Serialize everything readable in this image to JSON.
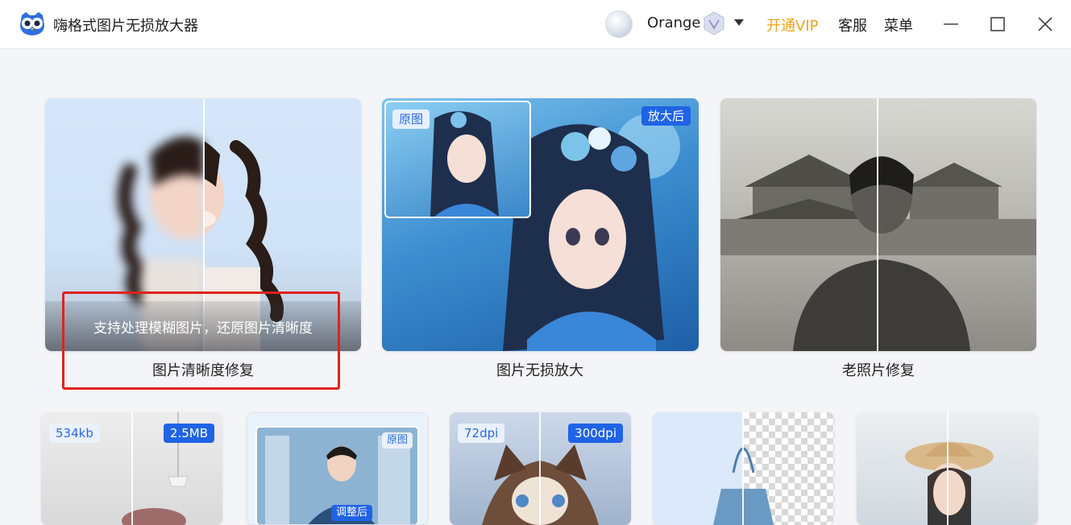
{
  "app": {
    "title": "嗨格式图片无损放大器"
  },
  "header": {
    "username": "Orange",
    "open_vip": "开通VIP",
    "support": "客服",
    "menu": "菜单"
  },
  "colors": {
    "accent_blue": "#1f63e6",
    "vip_orange": "#f0a21a",
    "highlight_red": "#e0231d"
  },
  "features": [
    {
      "caption": "图片清晰度修复",
      "overlay_text": "支持处理模糊图片，还原图片清晰度"
    },
    {
      "caption": "图片无损放大",
      "tag_before": "原图",
      "tag_after": "放大后"
    },
    {
      "caption": "老照片修复"
    }
  ],
  "small_cards": [
    {
      "tag_left": "534kb",
      "tag_right": "2.5MB"
    },
    {
      "tag_top": "原图",
      "tag_bottom": "调整后"
    },
    {
      "tag_left": "72dpi",
      "tag_right": "300dpi"
    },
    {},
    {}
  ]
}
